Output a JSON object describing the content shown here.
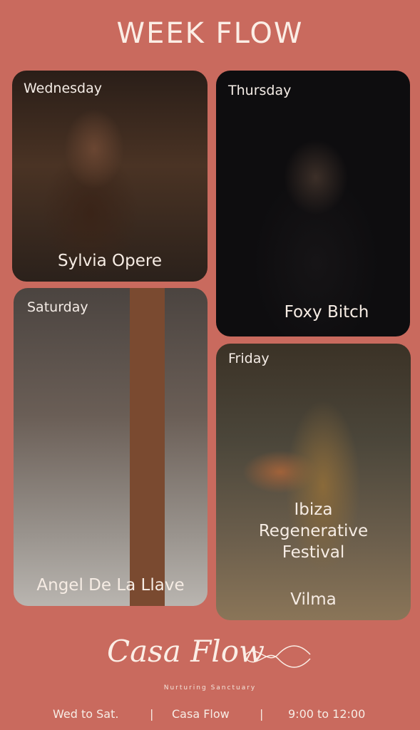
{
  "header": {
    "title": "WEEK FLOW"
  },
  "events": [
    {
      "day": "Wednesday",
      "artist": "Sylvia Opere"
    },
    {
      "day": "Thursday",
      "artist": "Foxy Bitch"
    },
    {
      "day": "Saturday",
      "artist": "Angel De La Llave"
    },
    {
      "day": "Friday",
      "event_lines": [
        "Ibiza",
        "Regenerative",
        "Festival"
      ],
      "artist": "Vilma"
    }
  ],
  "brand": {
    "logo_text": "Casa Flow",
    "tagline": "Nurturing Sanctuary"
  },
  "footer": {
    "days": "Wed to Sat.",
    "sep": "|",
    "venue": "Casa Flow",
    "hours": "9:00 to 12:00"
  },
  "colors": {
    "background": "#c96a5e",
    "text": "#fbeee6"
  }
}
